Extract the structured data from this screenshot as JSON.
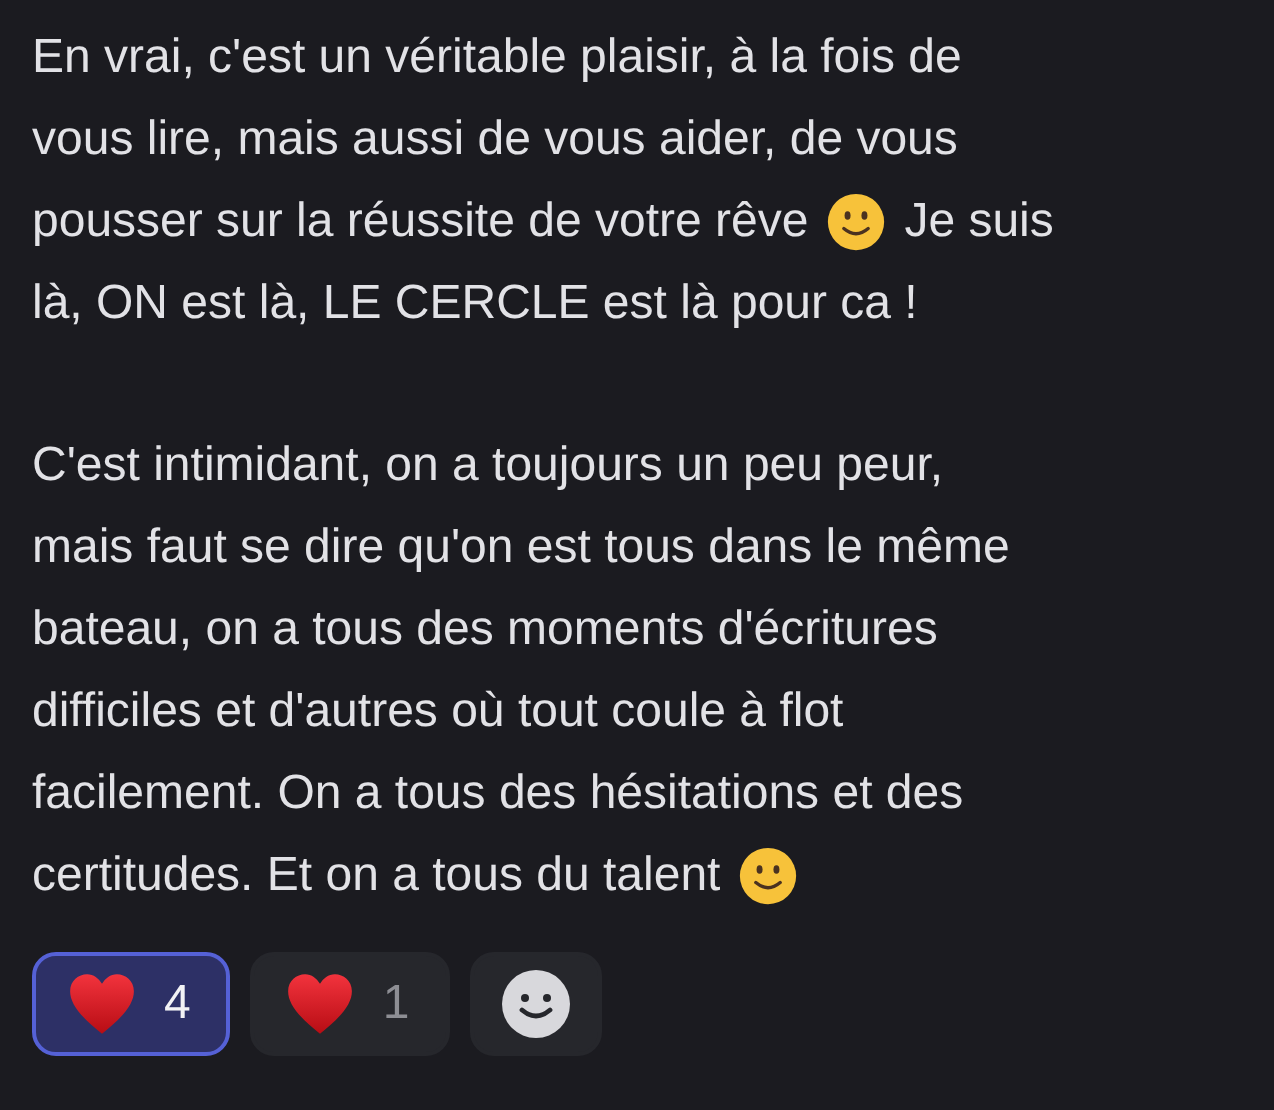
{
  "paragraphs": [
    {
      "lines": [
        [
          {
            "kind": "text",
            "text": "En vrai, c'est un véritable plaisir, à la fois de"
          }
        ],
        [
          {
            "kind": "text",
            "text": "vous lire, mais aussi de vous aider, de vous"
          }
        ],
        [
          {
            "kind": "text",
            "text": "pousser sur la réussite de votre rêve"
          },
          {
            "kind": "emoji"
          },
          {
            "kind": "text",
            "text": "Je suis"
          }
        ],
        [
          {
            "kind": "text",
            "text": "là, ON est là, LE CERCLE est là pour ca !"
          }
        ]
      ]
    },
    {
      "lines": [
        [
          {
            "kind": "text",
            "text": "C'est intimidant, on a toujours un peu peur,"
          }
        ],
        [
          {
            "kind": "text",
            "text": "mais faut se dire qu'on est tous dans le même"
          }
        ],
        [
          {
            "kind": "text",
            "text": "bateau, on a tous des moments d'écritures"
          }
        ],
        [
          {
            "kind": "text",
            "text": "difficiles et d'autres où tout coule à flot"
          }
        ],
        [
          {
            "kind": "text",
            "text": "facilement. On a tous des hésitations et des"
          }
        ],
        [
          {
            "kind": "text",
            "text": "certitudes. Et on a tous du talent"
          },
          {
            "kind": "emoji"
          }
        ]
      ]
    }
  ],
  "reactions": [
    {
      "kind": "heart",
      "count": "4",
      "selected": true
    },
    {
      "kind": "heart",
      "count": "1",
      "selected": false
    },
    {
      "kind": "add"
    }
  ]
}
